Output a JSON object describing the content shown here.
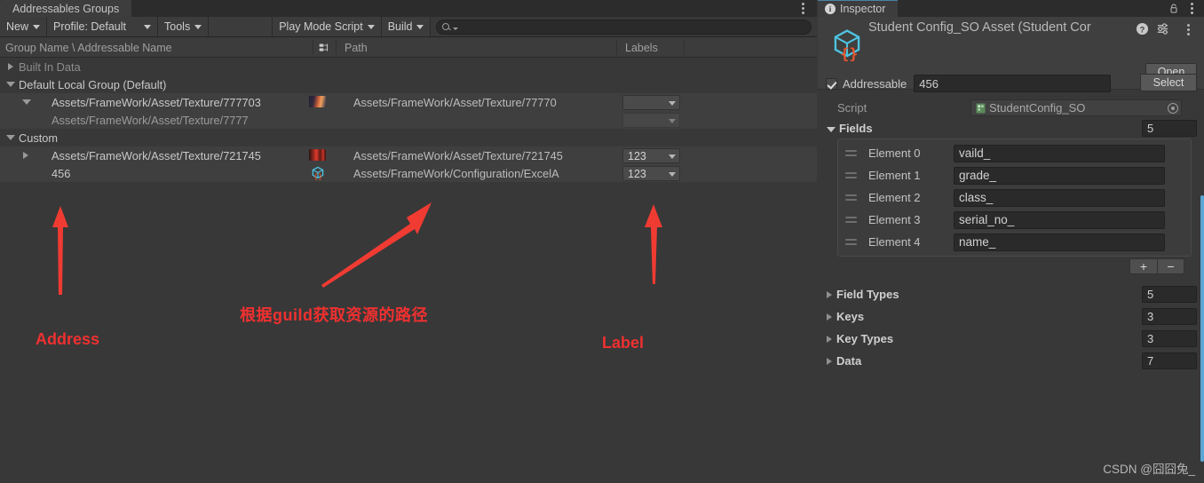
{
  "window": {
    "left_tab": "Addressables Groups",
    "right_tab": "Inspector"
  },
  "toolbar": {
    "new_label": "New",
    "profile_label": "Profile: Default",
    "tools_label": "Tools",
    "play_mode_script_label": "Play Mode Script",
    "build_label": "Build",
    "search_value": "",
    "search_placeholder": ""
  },
  "columns": {
    "group_name": "Group Name \\ Addressable Name",
    "path": "Path",
    "labels": "Labels"
  },
  "tree": [
    {
      "name": "Built In Data",
      "type": "group",
      "expanded": false,
      "path": "",
      "label": null,
      "indent": 0
    },
    {
      "name": "Default Local Group (Default)",
      "type": "group",
      "expanded": true,
      "path": "",
      "label": null,
      "indent": 0
    },
    {
      "name": "Assets/FrameWork/Asset/Texture/777703",
      "type": "entry",
      "expanded": true,
      "path": "Assets/FrameWork/Asset/Texture/77770",
      "label": "",
      "indent": 1,
      "icon": "texture-thumbnail-blue"
    },
    {
      "name": "Assets/FrameWork/Asset/Texture/7777",
      "type": "sub-entry",
      "expanded": null,
      "path": "",
      "label": "",
      "indent": 2,
      "icon": null
    },
    {
      "name": "Custom",
      "type": "group",
      "expanded": true,
      "path": "",
      "label": null,
      "indent": 0
    },
    {
      "name": "Assets/FrameWork/Asset/Texture/721745",
      "type": "entry",
      "expanded": false,
      "path": "Assets/FrameWork/Asset/Texture/721745",
      "label": "123",
      "indent": 1,
      "icon": "texture-thumbnail-red"
    },
    {
      "name": "456",
      "type": "entry",
      "expanded": null,
      "path": "Assets/FrameWork/Configuration/ExcelA",
      "label": "123",
      "indent": 1,
      "icon": "scriptable-object-icon"
    }
  ],
  "annotations": {
    "address": "Address",
    "label": "Label",
    "chinese_note": "根据guild获取资源的路径",
    "color": "#f03030"
  },
  "inspector": {
    "tab_label": "Inspector",
    "asset_title": "Student Config_SO Asset (Student Cor",
    "open_button": "Open",
    "select_button": "Select",
    "addressable_label": "Addressable",
    "addressable_value": "456",
    "addressable_checked": true,
    "script_label": "Script",
    "script_value": "StudentConfig_SO",
    "fields_label": "Fields",
    "fields_size": "5",
    "elements": [
      {
        "label": "Element 0",
        "value": "vaild_"
      },
      {
        "label": "Element 1",
        "value": "grade_"
      },
      {
        "label": "Element 2",
        "value": "class_"
      },
      {
        "label": "Element 3",
        "value": "serial_no_"
      },
      {
        "label": "Element 4",
        "value": "name_"
      }
    ],
    "add_button": "+",
    "remove_button": "−",
    "collapsed_props": [
      {
        "label": "Field Types",
        "size": "5"
      },
      {
        "label": "Keys",
        "size": "3"
      },
      {
        "label": "Key Types",
        "size": "3"
      },
      {
        "label": "Data",
        "size": "7"
      }
    ]
  },
  "watermark": "CSDN @囧囧兔_"
}
